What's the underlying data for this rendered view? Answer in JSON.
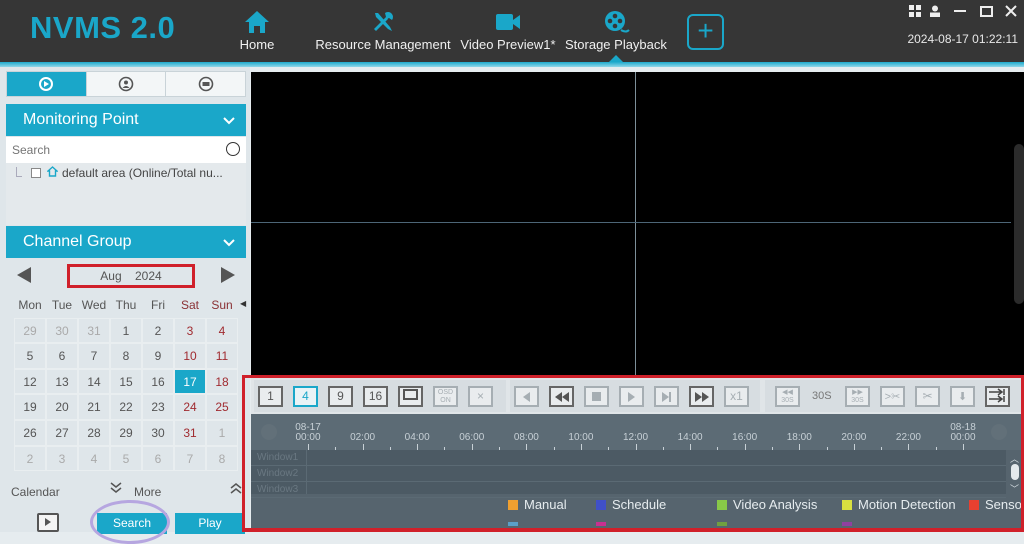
{
  "app": {
    "logo": "NVMS 2.0",
    "clock": "2024-08-17 01:22:11"
  },
  "nav": {
    "items": [
      {
        "label": "Home",
        "icon": "home-icon"
      },
      {
        "label": "Resource Management",
        "icon": "tools-icon"
      },
      {
        "label": "Video Preview1*",
        "icon": "video-camera-icon"
      },
      {
        "label": "Storage Playback",
        "icon": "film-reel-icon",
        "active": true
      }
    ],
    "add_tab": "+"
  },
  "window_controls": {
    "grid": "▦",
    "user": "👤",
    "minimize": "—",
    "maximize": "☐",
    "close": "✕"
  },
  "left_panel": {
    "tabs": [
      {
        "icon": "playback-icon",
        "active": true
      },
      {
        "icon": "face-playback-icon",
        "active": false
      },
      {
        "icon": "vehicle-playback-icon",
        "active": false
      }
    ],
    "monitoring_point": {
      "title": "Monitoring Point",
      "search_placeholder": "Search",
      "tree": [
        {
          "label": "default area (Online/Total nu..."
        }
      ]
    },
    "channel_group": {
      "title": "Channel Group"
    },
    "calendar": {
      "month": "Aug",
      "year": "2024",
      "title": "Aug 2024",
      "weekdays": [
        "Mon",
        "Tue",
        "Wed",
        "Thu",
        "Fri",
        "Sat",
        "Sun"
      ],
      "selected": "17",
      "weeks": [
        [
          "29",
          "30",
          "31",
          "1",
          "2",
          "3",
          "4"
        ],
        [
          "5",
          "6",
          "7",
          "8",
          "9",
          "10",
          "11"
        ],
        [
          "12",
          "13",
          "14",
          "15",
          "16",
          "17",
          "18"
        ],
        [
          "19",
          "20",
          "21",
          "22",
          "23",
          "24",
          "25"
        ],
        [
          "26",
          "27",
          "28",
          "29",
          "30",
          "31",
          "1"
        ],
        [
          "2",
          "3",
          "4",
          "5",
          "6",
          "7",
          "8"
        ]
      ],
      "other_month_mask": [
        [
          1,
          1,
          1,
          0,
          0,
          0,
          0
        ],
        [
          0,
          0,
          0,
          0,
          0,
          0,
          0
        ],
        [
          0,
          0,
          0,
          0,
          0,
          0,
          0
        ],
        [
          0,
          0,
          0,
          0,
          0,
          0,
          0
        ],
        [
          0,
          0,
          0,
          0,
          0,
          0,
          1
        ],
        [
          1,
          1,
          1,
          1,
          1,
          1,
          1
        ]
      ]
    },
    "footer": {
      "calendar_label": "Calendar",
      "more_label": "More"
    },
    "buttons": {
      "search": "Search",
      "play": "Play"
    }
  },
  "toolbar": {
    "split_buttons": [
      "1",
      "4",
      "9",
      "16"
    ],
    "active_split": "4",
    "osd": "OSD ON",
    "speed": "x1",
    "skip_back": "30S",
    "skip_label": "30S",
    "skip_fwd": "30S"
  },
  "timeline": {
    "start_date": "08-17",
    "end_date": "08-18",
    "hours": [
      "00:00",
      "02:00",
      "04:00",
      "06:00",
      "08:00",
      "10:00",
      "12:00",
      "14:00",
      "16:00",
      "18:00",
      "20:00",
      "22:00",
      "00:00"
    ],
    "rows": [
      "Window1",
      "Window2",
      "Window3"
    ],
    "legend": [
      {
        "label": "Manual",
        "color": "#f0a030"
      },
      {
        "label": "Schedule",
        "color": "#4050c8"
      },
      {
        "label": "Video Analysis",
        "color": "#88c848"
      },
      {
        "label": "Motion Detection",
        "color": "#d8e040"
      },
      {
        "label": "Sensor",
        "color": "#e84030"
      }
    ],
    "legend_second_row_colors": [
      "#5aa0c8",
      "#c83090",
      "#70a040",
      "#9040a0"
    ]
  },
  "colors": {
    "accent": "#1aa7c9",
    "topbar": "#363636",
    "highlight_red": "#d0202a",
    "highlight_purple": "#b6a6e0"
  }
}
